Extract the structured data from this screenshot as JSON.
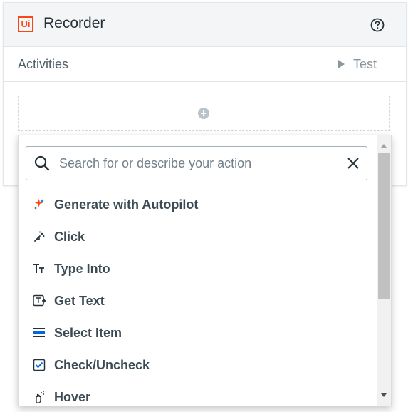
{
  "app": {
    "logo_text": "Ui",
    "title": "Recorder",
    "help_icon": "help-circle-icon",
    "brand_color": "#fa4616"
  },
  "toolbar": {
    "activities_label": "Activities",
    "test_label": "Test",
    "test_icon": "play-icon"
  },
  "drop_zone": {
    "add_icon": "plus-circle-icon"
  },
  "search": {
    "placeholder": "Search for or describe your action",
    "value": "",
    "search_icon": "magnifier-icon",
    "clear_icon": "close-icon"
  },
  "actions": [
    {
      "label": "Generate with Autopilot",
      "icon": "autopilot-sparkle-icon"
    },
    {
      "label": "Click",
      "icon": "click-icon"
    },
    {
      "label": "Type Into",
      "icon": "type-into-icon"
    },
    {
      "label": "Get Text",
      "icon": "get-text-icon"
    },
    {
      "label": "Select Item",
      "icon": "select-item-icon"
    },
    {
      "label": "Check/Uncheck",
      "icon": "checkbox-icon"
    },
    {
      "label": "Hover",
      "icon": "hover-icon"
    }
  ]
}
